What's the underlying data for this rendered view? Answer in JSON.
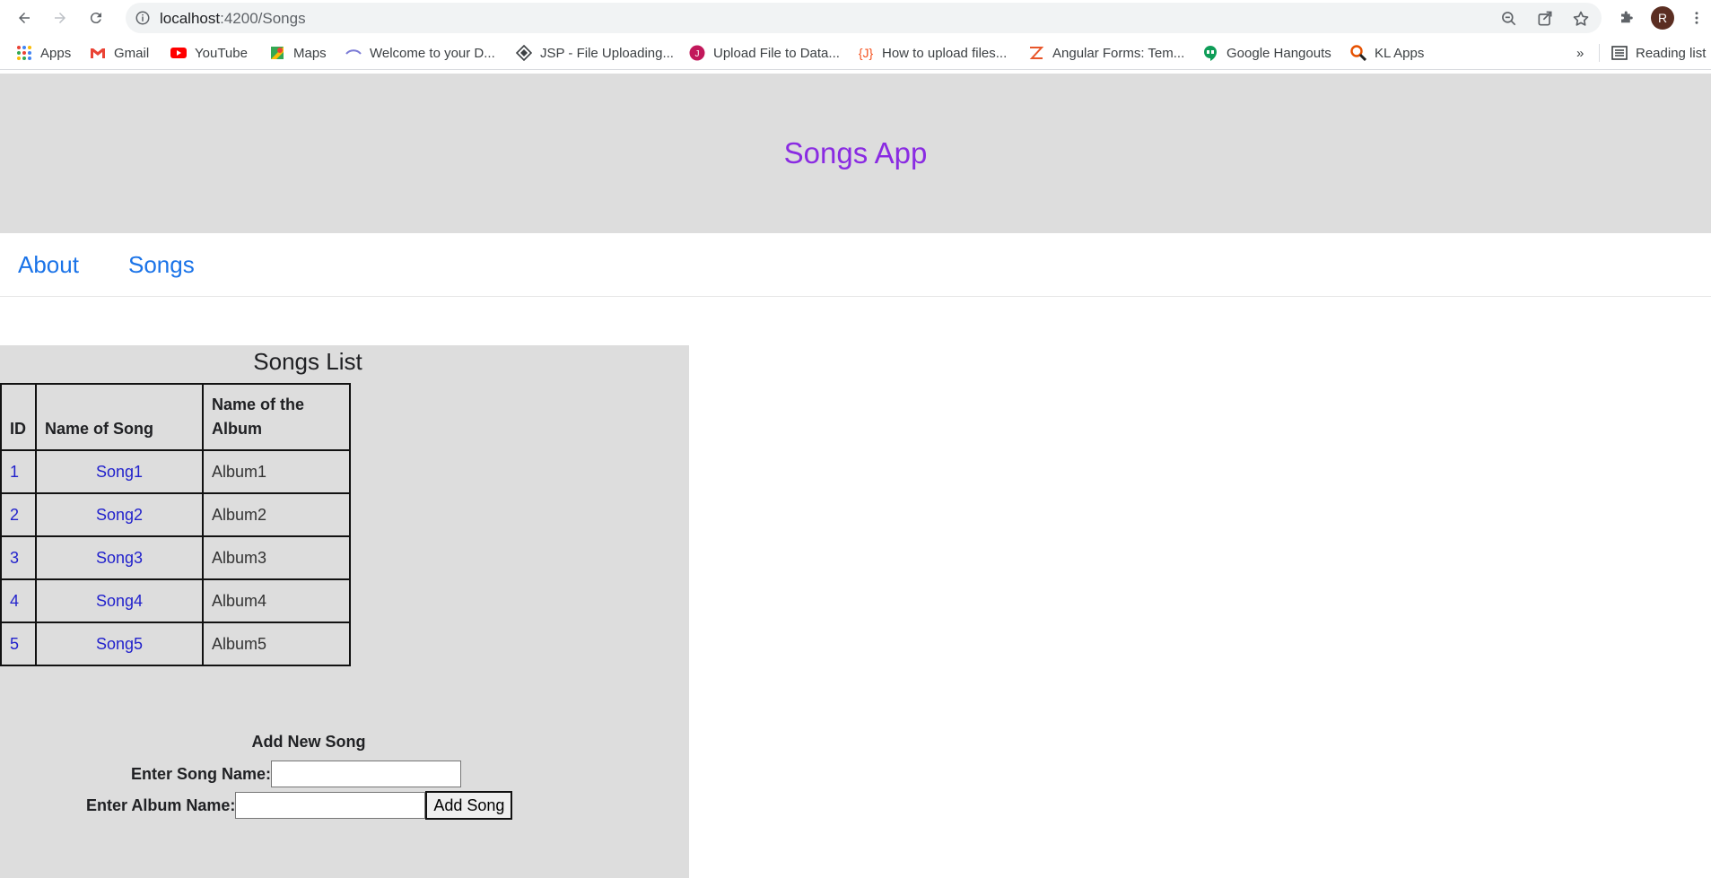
{
  "browser": {
    "url_host": "localhost",
    "url_path": ":4200/Songs",
    "profile_initial": "R",
    "bookmarks": [
      {
        "label": "Apps"
      },
      {
        "label": "Gmail"
      },
      {
        "label": "YouTube"
      },
      {
        "label": "Maps"
      },
      {
        "label": "Welcome to your D..."
      },
      {
        "label": "JSP - File Uploading..."
      },
      {
        "label": "Upload File to Data..."
      },
      {
        "label": "How to upload files..."
      },
      {
        "label": "Angular Forms: Tem..."
      },
      {
        "label": "Google Hangouts"
      },
      {
        "label": "KL Apps"
      }
    ],
    "overflow": "»",
    "reading_list": "Reading list"
  },
  "app": {
    "title": "Songs App",
    "nav": [
      {
        "label": "About"
      },
      {
        "label": "Songs"
      }
    ],
    "list_title": "Songs List",
    "columns": [
      "ID",
      "Name of Song",
      "Name of the Album"
    ],
    "rows": [
      {
        "id": "1",
        "song": "Song1",
        "album": "Album1"
      },
      {
        "id": "2",
        "song": "Song2",
        "album": "Album2"
      },
      {
        "id": "3",
        "song": "Song3",
        "album": "Album3"
      },
      {
        "id": "4",
        "song": "Song4",
        "album": "Album4"
      },
      {
        "id": "5",
        "song": "Song5",
        "album": "Album5"
      }
    ],
    "form": {
      "title": "Add New Song",
      "song_label": "Enter Song Name:",
      "album_label": "Enter Album Name:",
      "song_value": "",
      "album_value": "",
      "submit_label": "Add Song"
    }
  },
  "colors": {
    "title": "#8a2be2",
    "nav_link": "#1a73e8",
    "table_link": "#2222cc",
    "panel_bg": "#dddddd"
  }
}
